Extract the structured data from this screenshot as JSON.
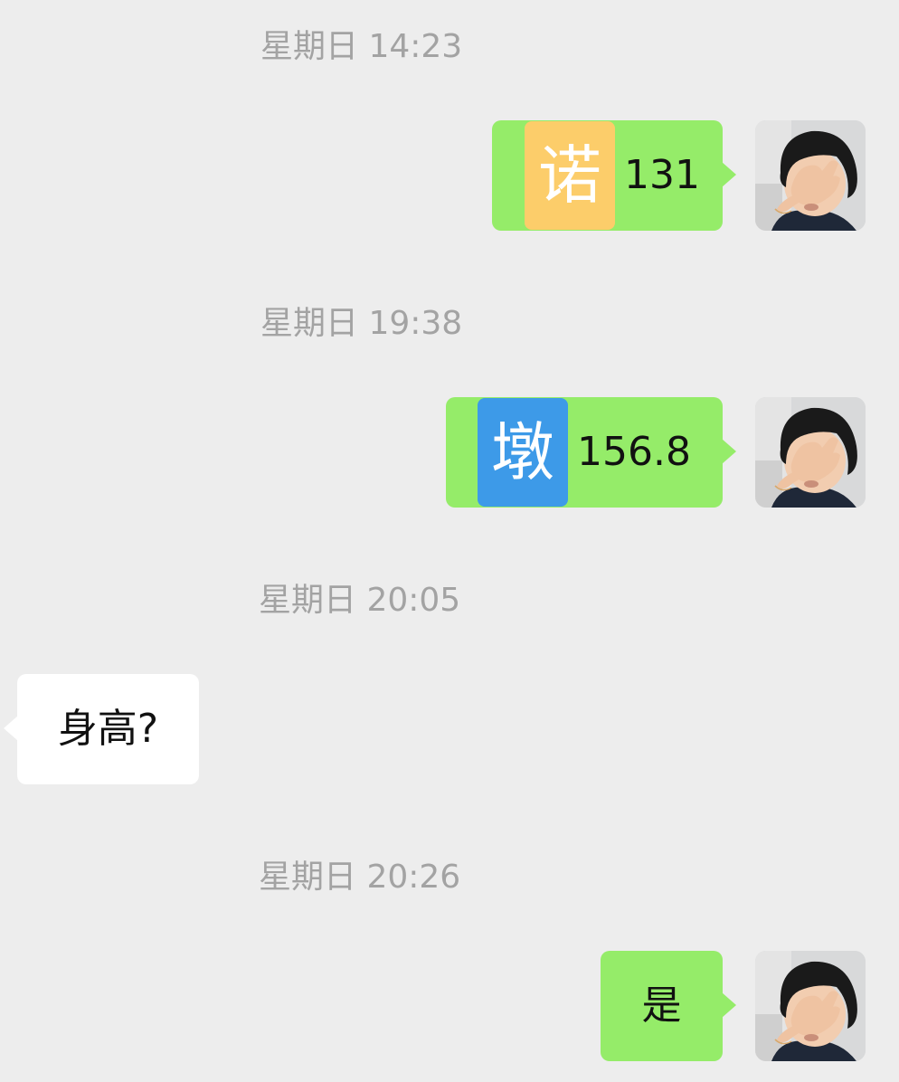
{
  "colors": {
    "background": "#ededed",
    "outgoing_bubble": "#95ec69",
    "incoming_bubble": "#ffffff",
    "timestamp_text": "#a3a3a3",
    "icon_orange": "#fccd6a",
    "icon_blue": "#3d9ae8"
  },
  "messages": [
    {
      "timestamp": "星期日 14:23",
      "direction": "out",
      "icon_char": "诺",
      "icon_color": "orange",
      "text": "131",
      "avatar": "child-covering-face-avatar"
    },
    {
      "timestamp": "星期日 19:38",
      "direction": "out",
      "icon_char": "墩",
      "icon_color": "blue",
      "text": "156.8",
      "avatar": "child-covering-face-avatar"
    },
    {
      "timestamp": "星期日 20:05",
      "direction": "in",
      "text": "身高?"
    },
    {
      "timestamp": "星期日 20:26",
      "direction": "out",
      "text": "是",
      "avatar": "child-covering-face-avatar"
    }
  ]
}
